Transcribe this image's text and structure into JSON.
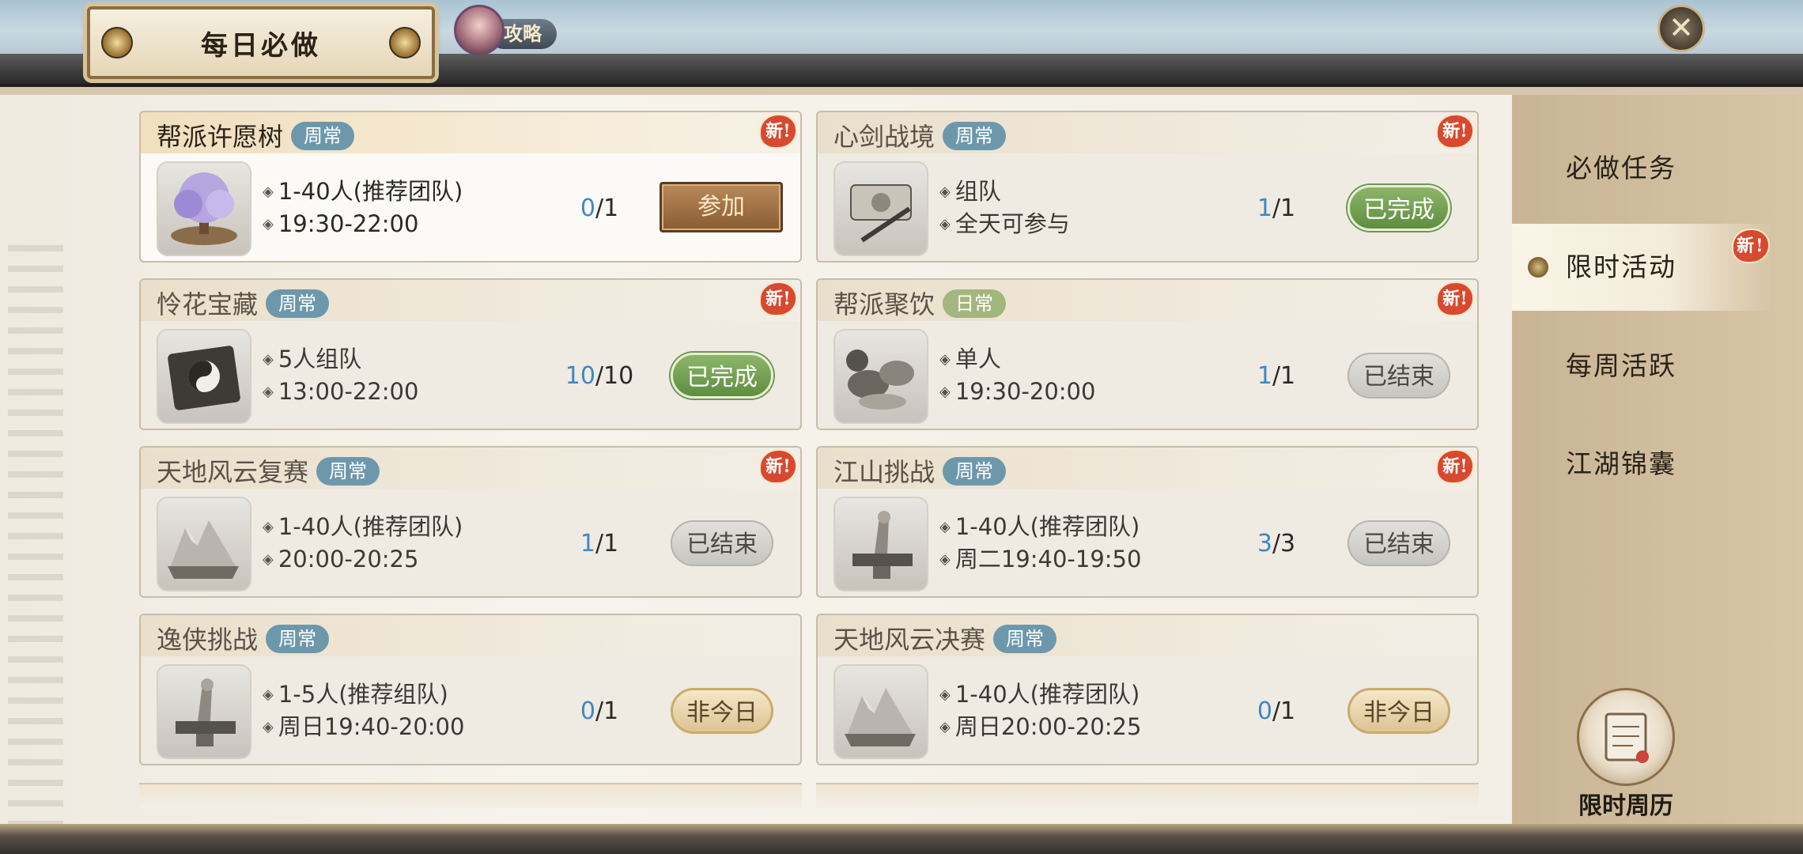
{
  "window": {
    "title": "每日必做",
    "guide_label": "攻略"
  },
  "icons": {
    "close": "close-icon",
    "guide": "avatar-icon",
    "calendar": "calendar-book-icon"
  },
  "colors": {
    "progress_current": "#3d87c9",
    "tag_blue": "#6d98ac",
    "tag_green": "#a3b67e",
    "new_badge": "#d8492f"
  },
  "cards": [
    {
      "title": "帮派许愿树",
      "tag": "周常",
      "tag_color": "blue",
      "new": "新!",
      "line1": "1-40人(推荐团队)",
      "line2": "19:30-22:00",
      "progress_current": "0",
      "progress_total": "/1",
      "action": "参加",
      "action_type": "join",
      "thumb": "wishing-tree-icon"
    },
    {
      "title": "心剑战境",
      "tag": "周常",
      "tag_color": "blue",
      "new": "新!",
      "line1": "组队",
      "line2": "全天可参与",
      "progress_current": "1",
      "progress_total": "/1",
      "action": "已完成",
      "action_type": "done",
      "thumb": "scroll-sword-icon"
    },
    {
      "title": "怜花宝藏",
      "tag": "周常",
      "tag_color": "blue",
      "new": "新!",
      "line1": "5人组队",
      "line2": "13:00-22:00",
      "progress_current": "10",
      "progress_total": "/10",
      "action": "已完成",
      "action_type": "done",
      "thumb": "bagua-board-icon"
    },
    {
      "title": "帮派聚饮",
      "tag": "日常",
      "tag_color": "green",
      "new": "新!",
      "line1": "单人",
      "line2": "19:30-20:00",
      "progress_current": "1",
      "progress_total": "/1",
      "action": "已结束",
      "action_type": "ended",
      "thumb": "feast-bowls-icon"
    },
    {
      "title": "天地风云复赛",
      "tag": "周常",
      "tag_color": "blue",
      "new": "新!",
      "line1": "1-40人(推荐团队)",
      "line2": "20:00-20:25",
      "progress_current": "1",
      "progress_total": "/1",
      "action": "已结束",
      "action_type": "ended",
      "thumb": "mountain-diorama-icon"
    },
    {
      "title": "江山挑战",
      "tag": "周常",
      "tag_color": "blue",
      "new": "新!",
      "line1": "1-40人(推荐团队)",
      "line2": "周二19:40-19:50",
      "progress_current": "3",
      "progress_total": "/3",
      "action": "已结束",
      "action_type": "ended",
      "thumb": "anvil-statue-icon"
    },
    {
      "title": "逸侠挑战",
      "tag": "周常",
      "tag_color": "blue",
      "new": "",
      "line1": "1-5人(推荐组队)",
      "line2": "周日19:40-20:00",
      "progress_current": "0",
      "progress_total": "/1",
      "action": "非今日",
      "action_type": "notoday",
      "thumb": "anvil-statue-icon"
    },
    {
      "title": "天地风云决赛",
      "tag": "周常",
      "tag_color": "blue",
      "new": "",
      "line1": "1-40人(推荐团队)",
      "line2": "周日20:00-20:25",
      "progress_current": "0",
      "progress_total": "/1",
      "action": "非今日",
      "action_type": "notoday",
      "thumb": "mountain-diorama-icon"
    }
  ],
  "sidebar": {
    "items": [
      {
        "label": "必做任务",
        "active": false,
        "new": ""
      },
      {
        "label": "限时活动",
        "active": true,
        "new": "新!"
      },
      {
        "label": "每周活跃",
        "active": false,
        "new": ""
      },
      {
        "label": "江湖锦囊",
        "active": false,
        "new": ""
      }
    ],
    "calendar_label": "限时周历"
  }
}
